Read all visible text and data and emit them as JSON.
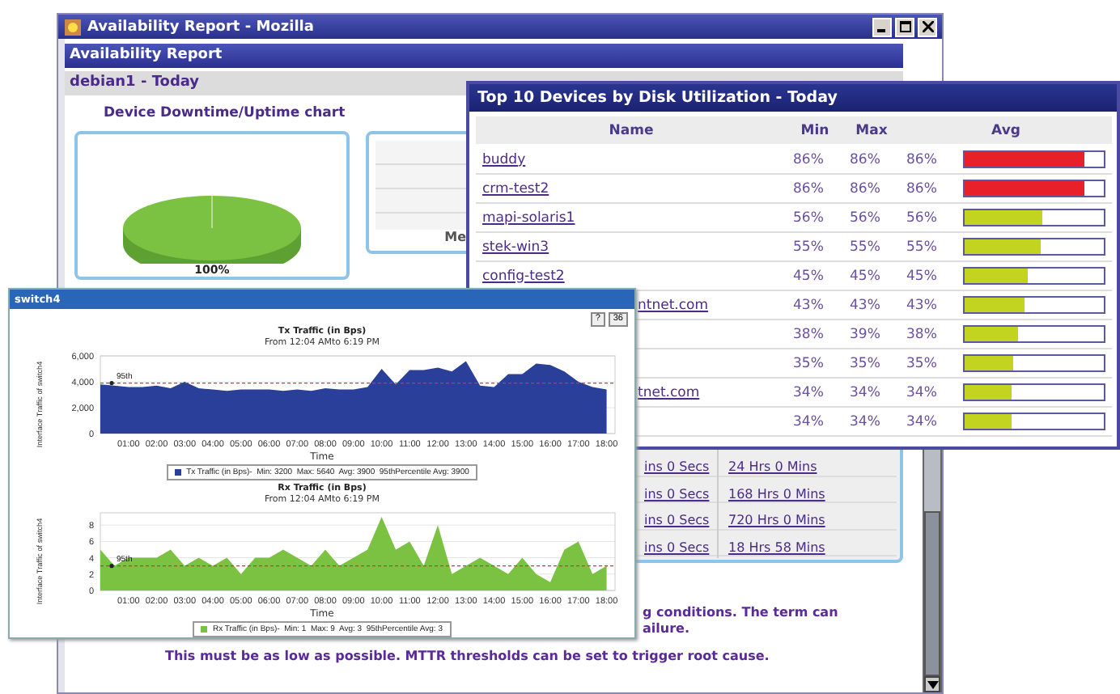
{
  "main_window": {
    "title": "Availability Report - Mozilla",
    "header": "Availability Report",
    "subheader": "debian1 - Today",
    "chart_title": "Device Downtime/Uptime chart",
    "pie": {
      "label": "100%"
    },
    "side_panel": {
      "text": "Me"
    },
    "durations": [
      {
        "left": "ins 0 Secs",
        "right": "24 Hrs 0 Mins"
      },
      {
        "left": "ins 0 Secs",
        "right": "168 Hrs 0 Mins"
      },
      {
        "left": "ins 0 Secs",
        "right": "720 Hrs 0 Mins"
      },
      {
        "left": "ins 0 Secs",
        "right": "18 Hrs 58 Mins"
      }
    ],
    "notes": [
      {
        "kind": "partial",
        "text": "g conditions. The term can"
      },
      {
        "kind": "partial",
        "text": "ailure."
      },
      {
        "kind": "full",
        "text": "This must be as low as possible. MTTR thresholds can be set to trigger root cause."
      }
    ]
  },
  "disk_window": {
    "title": "Top 10 Devices by Disk Utilization - Today",
    "columns": [
      "Name",
      "Min",
      "Max",
      "Avg"
    ],
    "rows": [
      {
        "kind": "full",
        "name": "buddy",
        "min": "86%",
        "max": "86%",
        "avg": "86%",
        "level": 0.86,
        "color": "#e8202a"
      },
      {
        "kind": "full",
        "name": "crm-test2",
        "min": "86%",
        "max": "86%",
        "avg": "86%",
        "level": 0.86,
        "color": "#e8202a"
      },
      {
        "kind": "full",
        "name": "mapi-solaris1",
        "min": "56%",
        "max": "56%",
        "avg": "56%",
        "level": 0.56,
        "color": "#c3d420"
      },
      {
        "kind": "full",
        "name": "stek-win3",
        "min": "55%",
        "max": "55%",
        "avg": "55%",
        "level": 0.55,
        "color": "#c3d420"
      },
      {
        "kind": "full",
        "name": "config-test2",
        "min": "45%",
        "max": "45%",
        "avg": "45%",
        "level": 0.45,
        "color": "#c3d420"
      },
      {
        "kind": "partial",
        "name": "ntnet.com",
        "min": "43%",
        "max": "43%",
        "avg": "43%",
        "level": 0.43,
        "color": "#c3d420"
      },
      {
        "kind": "partial",
        "min": "38%",
        "max": "39%",
        "avg": "38%",
        "level": 0.38,
        "color": "#c3d420"
      },
      {
        "kind": "partial",
        "min": "35%",
        "max": "35%",
        "avg": "35%",
        "level": 0.35,
        "color": "#c3d420"
      },
      {
        "kind": "partial",
        "name": "tnet.com",
        "min": "34%",
        "max": "34%",
        "avg": "34%",
        "level": 0.34,
        "color": "#c3d420"
      },
      {
        "kind": "partial",
        "min": "34%",
        "max": "34%",
        "avg": "34%",
        "level": 0.34,
        "color": "#c3d420"
      }
    ]
  },
  "switch_window": {
    "title": "switch4",
    "buttons": [
      "?",
      "36"
    ],
    "charts": [
      {
        "subtitle": "From 12:04 AMto 6:19 PM",
        "legend": "-  Min: 3200  Max: 5640  Avg: 3900  95thPercentile Avg: 3900",
        "chart_data": {
          "type": "area",
          "grid": true,
          "title": "Tx Traffic (in Bps)",
          "xlabel": "Time",
          "ylabel": "Interface Traffic of switch4",
          "xlim": [
            0,
            18.3
          ],
          "ylim": [
            0,
            6000
          ],
          "x": [
            0,
            0.5,
            1,
            1.5,
            2,
            2.5,
            3,
            3.5,
            4,
            4.5,
            5,
            5.5,
            6,
            6.5,
            7,
            7.5,
            8,
            8.5,
            9,
            9.5,
            10,
            10.5,
            11,
            11.5,
            12,
            12.5,
            13,
            13.5,
            14,
            14.5,
            15,
            15.5,
            16,
            16.5,
            17,
            17.5,
            18
          ],
          "series": [
            {
              "name": "Tx Traffic (in Bps)",
              "color": "#2a3f9a",
              "values": [
                3800,
                3700,
                3600,
                3600,
                3700,
                3500,
                4000,
                3500,
                3400,
                3300,
                3400,
                3400,
                3400,
                3300,
                3400,
                3300,
                3500,
                3400,
                3400,
                3600,
                5000,
                3800,
                4900,
                4900,
                5100,
                4800,
                5600,
                3700,
                3600,
                4600,
                4600,
                5400,
                5300,
                4800,
                4000,
                3600,
                3400
              ]
            }
          ],
          "xticks": [
            {
              "value": 1,
              "label": "01:00"
            },
            {
              "value": 2,
              "label": "02:00"
            },
            {
              "value": 3,
              "label": "03:00"
            },
            {
              "value": 4,
              "label": "04:00"
            },
            {
              "value": 5,
              "label": "05:00"
            },
            {
              "value": 6,
              "label": "06:00"
            },
            {
              "value": 7,
              "label": "07:00"
            },
            {
              "value": 8,
              "label": "08:00"
            },
            {
              "value": 9,
              "label": "09:00"
            },
            {
              "value": 10,
              "label": "10:00"
            },
            {
              "value": 11,
              "label": "11:00"
            },
            {
              "value": 12,
              "label": "12:00"
            },
            {
              "value": 13,
              "label": "13:00"
            },
            {
              "value": 14,
              "label": "14:00"
            },
            {
              "value": 15,
              "label": "15:00"
            },
            {
              "value": 16,
              "label": "16:00"
            },
            {
              "value": 17,
              "label": "17:00"
            },
            {
              "value": 18,
              "label": "18:00"
            }
          ],
          "yticks": [
            {
              "value": 0,
              "label": "0"
            },
            {
              "value": 2000,
              "label": "2,000"
            },
            {
              "value": 4000,
              "label": "4,000"
            },
            {
              "value": 6000,
              "label": "6,000"
            }
          ],
          "ref_lines": [
            {
              "axis": "y",
              "value": 3900,
              "label": "95th"
            }
          ]
        }
      },
      {
        "subtitle": "From 12:04 AMto 6:19 PM",
        "legend": "-  Min: 1  Max: 9  Avg: 3  95thPercentile Avg: 3",
        "chart_data": {
          "type": "area",
          "grid": true,
          "title": "Rx Traffic (in Bps)",
          "xlabel": "Time",
          "ylabel": "Interface Traffic of switch4",
          "xlim": [
            0,
            18.3
          ],
          "ylim": [
            0,
            9.5
          ],
          "x": [
            0,
            0.5,
            1,
            1.5,
            2,
            2.5,
            3,
            3.5,
            4,
            4.5,
            5,
            5.5,
            6,
            6.5,
            7,
            7.5,
            8,
            8.5,
            9,
            9.5,
            10,
            10.5,
            11,
            11.5,
            12,
            12.5,
            13,
            13.5,
            14,
            14.5,
            15,
            15.5,
            16,
            16.5,
            17,
            17.5,
            18
          ],
          "series": [
            {
              "name": "Rx Traffic (in Bps)",
              "color": "#7cc242",
              "values": [
                5,
                3,
                4,
                4,
                4,
                5,
                3,
                4,
                3,
                4,
                2,
                4,
                4,
                5,
                4,
                3,
                5,
                3,
                4,
                5,
                9,
                5,
                6,
                3,
                8,
                2,
                3,
                4,
                3,
                2,
                4,
                2,
                1,
                5,
                6,
                2,
                3
              ]
            }
          ],
          "xticks": [
            {
              "value": 1,
              "label": "01:00"
            },
            {
              "value": 2,
              "label": "02:00"
            },
            {
              "value": 3,
              "label": "03:00"
            },
            {
              "value": 4,
              "label": "04:00"
            },
            {
              "value": 5,
              "label": "05:00"
            },
            {
              "value": 6,
              "label": "06:00"
            },
            {
              "value": 7,
              "label": "07:00"
            },
            {
              "value": 8,
              "label": "08:00"
            },
            {
              "value": 9,
              "label": "09:00"
            },
            {
              "value": 10,
              "label": "10:00"
            },
            {
              "value": 11,
              "label": "11:00"
            },
            {
              "value": 12,
              "label": "12:00"
            },
            {
              "value": 13,
              "label": "13:00"
            },
            {
              "value": 14,
              "label": "14:00"
            },
            {
              "value": 15,
              "label": "15:00"
            },
            {
              "value": 16,
              "label": "16:00"
            },
            {
              "value": 17,
              "label": "17:00"
            },
            {
              "value": 18,
              "label": "18:00"
            }
          ],
          "yticks": [
            {
              "value": 0,
              "label": "0"
            },
            {
              "value": 2,
              "label": "2"
            },
            {
              "value": 4,
              "label": "4"
            },
            {
              "value": 6,
              "label": "6"
            },
            {
              "value": 8,
              "label": "8"
            }
          ],
          "ref_lines": [
            {
              "axis": "y",
              "value": 3,
              "label": "95th"
            }
          ]
        }
      }
    ]
  }
}
